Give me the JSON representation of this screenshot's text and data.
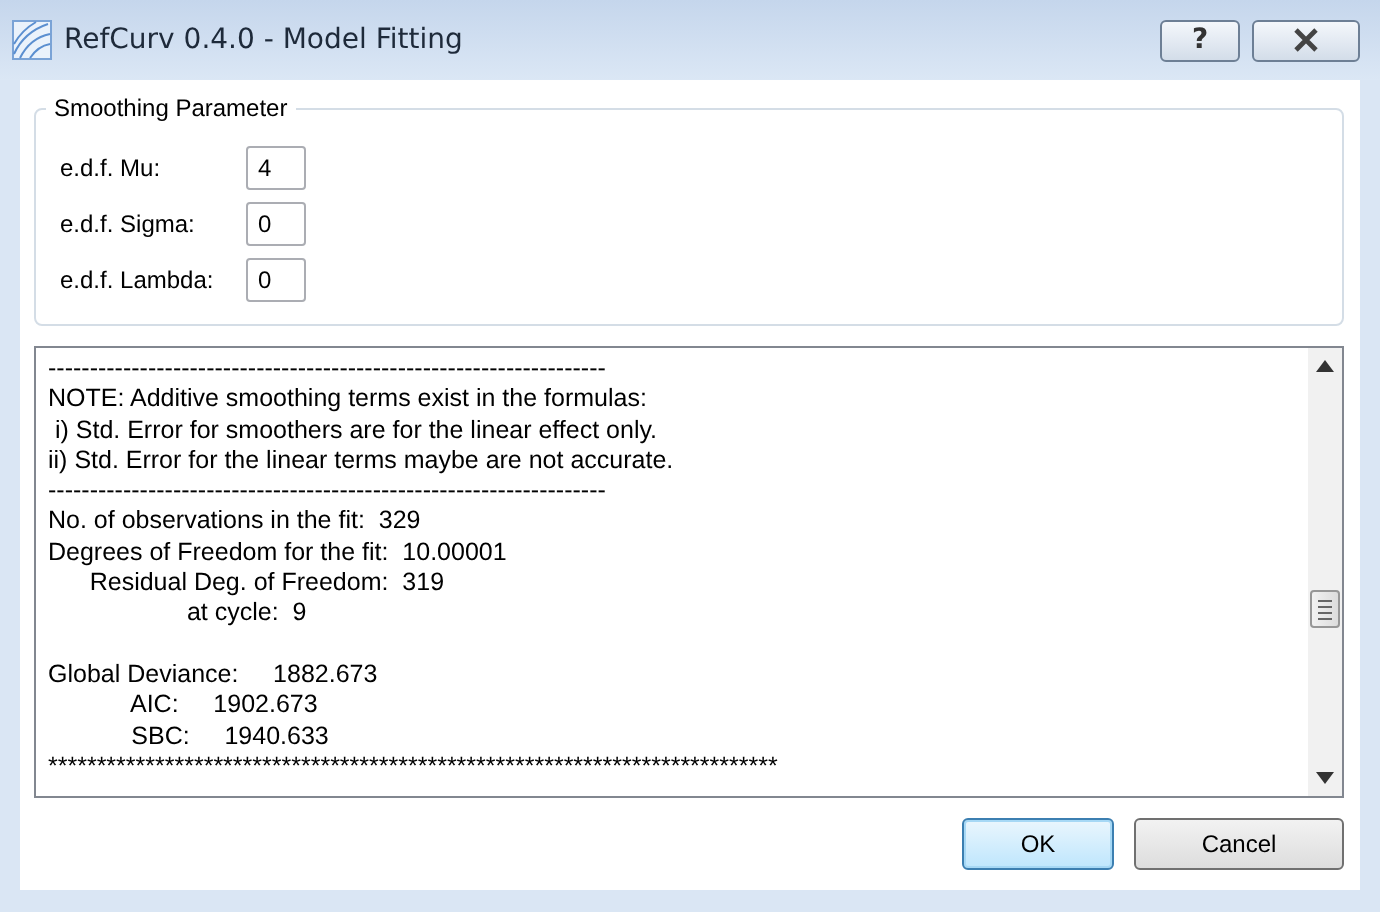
{
  "window": {
    "title": "RefCurv 0.4.0 - Model Fitting",
    "help_label": "?"
  },
  "smoothing": {
    "title": "Smoothing Parameter",
    "fields": [
      {
        "label": "e.d.f. Mu:",
        "value": "4"
      },
      {
        "label": "e.d.f. Sigma:",
        "value": "0"
      },
      {
        "label": "e.d.f. Lambda:",
        "value": "0"
      }
    ]
  },
  "output": {
    "blocks": [
      [
        "-------------------------------------------------------------------",
        "NOTE: Additive smoothing terms exist in the formulas:",
        " i) Std. Error for smoothers are for the linear effect only.",
        "ii) Std. Error for the linear terms maybe are not accurate.",
        "-------------------------------------------------------------------",
        "No. of observations in the fit:  329",
        "Degrees of Freedom for the fit:  10.00001",
        "      Residual Deg. of Freedom:  319",
        "                    at cycle:  9"
      ],
      [
        "Global Deviance:     1882.673",
        "            AIC:     1902.673",
        "            SBC:     1940.633",
        "***************************************************************************"
      ]
    ]
  },
  "buttons": [
    {
      "label": "OK",
      "selected": true
    },
    {
      "label": "Cancel",
      "selected": false
    }
  ]
}
